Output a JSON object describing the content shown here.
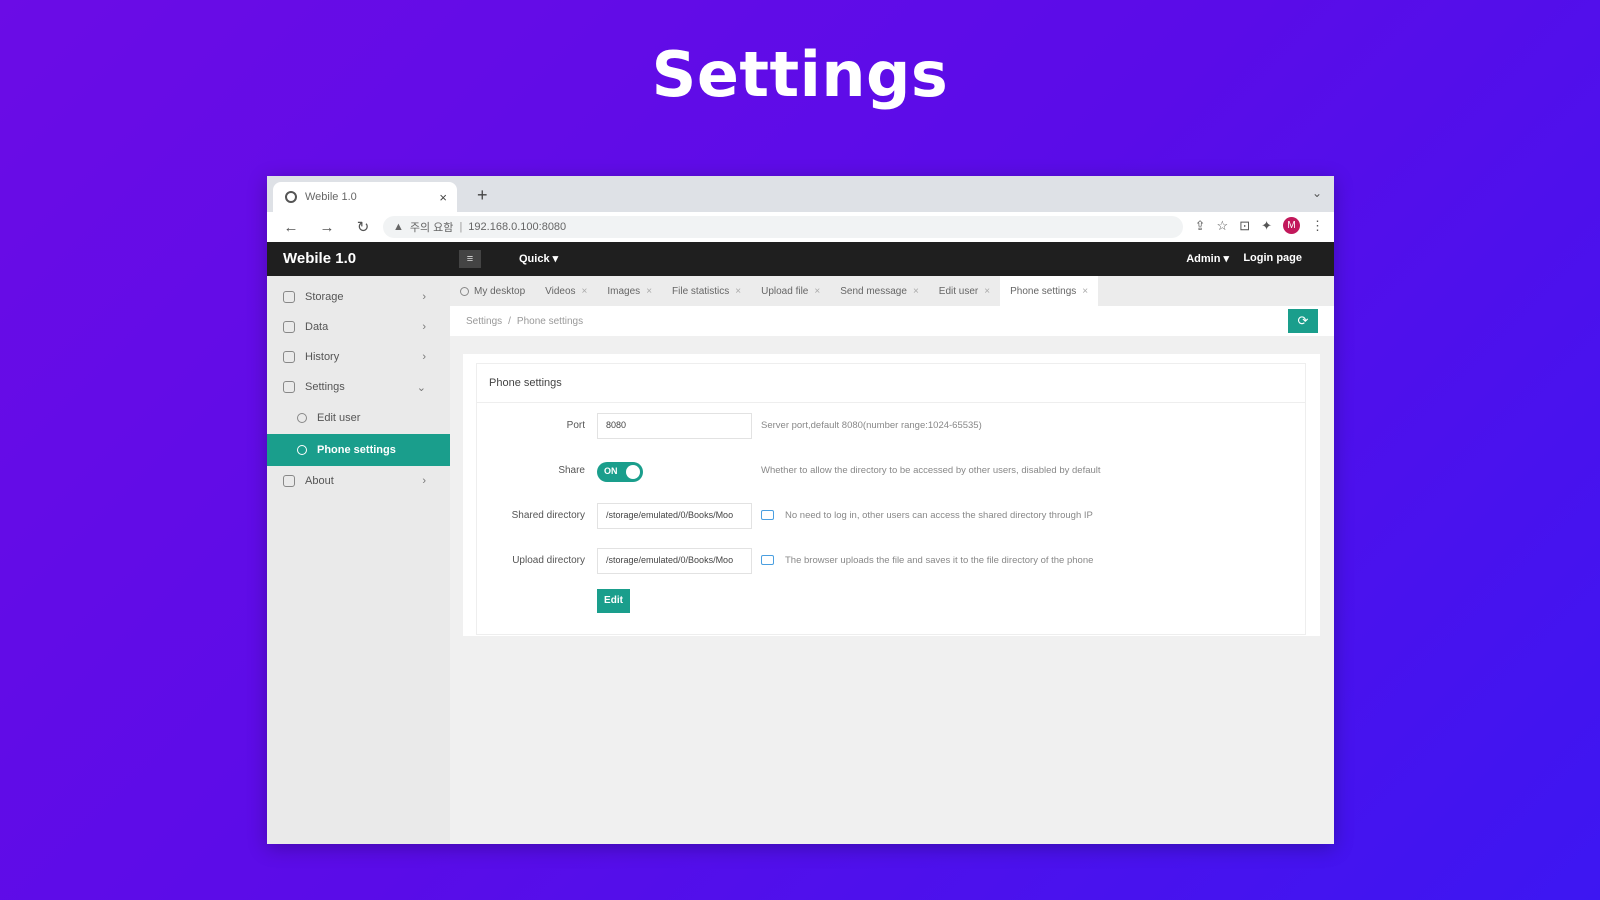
{
  "hero": {
    "title": "Settings"
  },
  "browser": {
    "tab_title": "Webile 1.0",
    "tab_close": "×",
    "new_tab": "+",
    "tabstrip_chevron": "⌄",
    "security_label": "주의 요함",
    "url": "192.168.0.100:8080",
    "profile_initial": "M",
    "nav_back": "←",
    "nav_forward": "→",
    "nav_reload": "↻"
  },
  "app": {
    "logo": "Webile 1.0",
    "menu_icon": "≡",
    "quick_label": "Quick ▾",
    "admin_label": "Admin ▾",
    "logout_label": "Login page"
  },
  "sidebar": {
    "items": [
      {
        "label": "Storage",
        "icon": "storage-icon",
        "arrow": "›"
      },
      {
        "label": "Data",
        "icon": "data-icon",
        "arrow": "›"
      },
      {
        "label": "History",
        "icon": "history-icon",
        "arrow": "›"
      },
      {
        "label": "Settings",
        "icon": "settings-icon",
        "arrow": "⌄"
      }
    ],
    "sub_items": [
      {
        "label": "Edit user",
        "icon": "user-icon"
      },
      {
        "label": "Phone settings",
        "icon": "phone-icon",
        "active": true
      }
    ],
    "about": {
      "label": "About",
      "icon": "info-icon",
      "arrow": "›"
    }
  },
  "tabs": [
    {
      "label": "My desktop",
      "close": ""
    },
    {
      "label": "Videos",
      "close": "×"
    },
    {
      "label": "Images",
      "close": "×"
    },
    {
      "label": "File statistics",
      "close": "×"
    },
    {
      "label": "Upload file",
      "close": "×"
    },
    {
      "label": "Send message",
      "close": "×"
    },
    {
      "label": "Edit user",
      "close": "×"
    },
    {
      "label": "Phone settings",
      "close": "×",
      "active": true
    }
  ],
  "breadcrumb": {
    "parent": "Settings",
    "separator": "/",
    "current": "Phone settings"
  },
  "refresh_icon": "⟳",
  "form": {
    "title": "Phone settings",
    "port": {
      "label": "Port",
      "value": "8080",
      "hint": "Server port,default 8080(number range:1024-65535)"
    },
    "share": {
      "label": "Share",
      "toggle": "ON",
      "hint": "Whether to allow the directory to be accessed by other users, disabled by default"
    },
    "shared_dir": {
      "label": "Shared directory",
      "value": "/storage/emulated/0/Books/Moo",
      "hint": "No need to log in, other users can access the shared directory through IP"
    },
    "upload_dir": {
      "label": "Upload directory",
      "value": "/storage/emulated/0/Books/Moo",
      "hint": "The browser uploads the file and saves it to the file directory of the phone"
    },
    "edit_label": "Edit"
  },
  "colors": {
    "accent": "#1a9e8c",
    "header": "#1f1f1f",
    "background_gradient": [
      "#6b0ce6",
      "#3d16f2"
    ]
  }
}
